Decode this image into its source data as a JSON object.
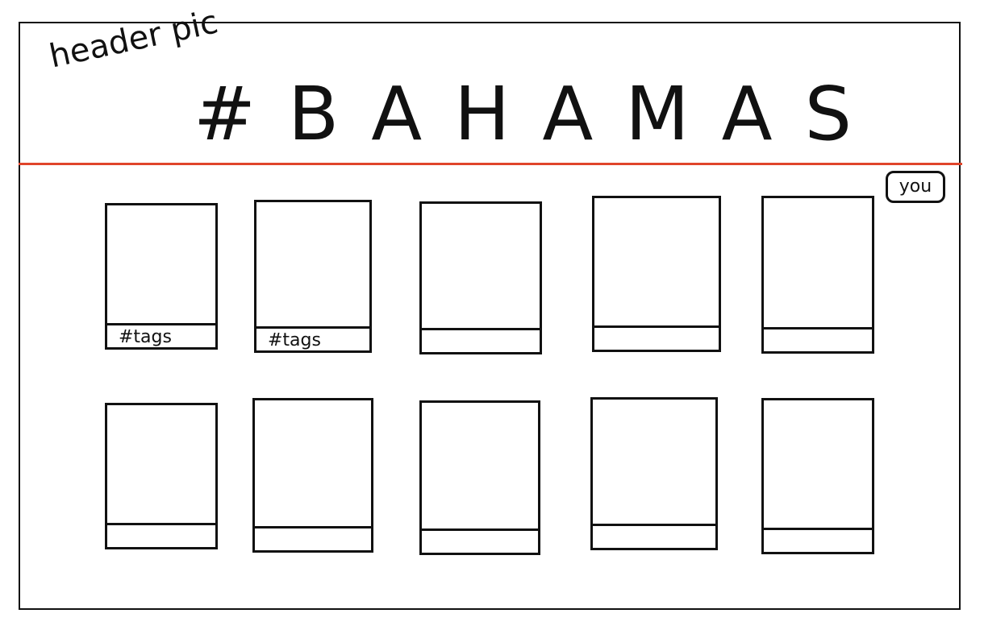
{
  "header": {
    "annotation": "header pic",
    "title": "#BAHAMAS"
  },
  "you_badge": "you",
  "grid": {
    "row1": [
      {
        "caption": "#tags"
      },
      {
        "caption": "#tags"
      },
      {
        "caption": ""
      },
      {
        "caption": ""
      },
      {
        "caption": ""
      }
    ],
    "row2": [
      {
        "caption": ""
      },
      {
        "caption": ""
      },
      {
        "caption": ""
      },
      {
        "caption": ""
      },
      {
        "caption": ""
      }
    ]
  },
  "colors": {
    "divider": "#e0452b",
    "ink": "#111111"
  }
}
